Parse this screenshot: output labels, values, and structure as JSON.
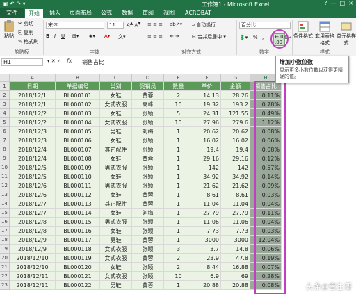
{
  "window": {
    "title": "工作簿1 - Microsoft Excel",
    "controls": [
      "?",
      "—",
      "□",
      "×"
    ]
  },
  "ribbon_tabs": [
    "文件",
    "开始",
    "插入",
    "页面布局",
    "公式",
    "数据",
    "审阅",
    "视图",
    "ACROBAT"
  ],
  "active_tab": "开始",
  "clipboard": {
    "paste": "粘贴",
    "cut": "剪切",
    "copy": "复制",
    "format_painter": "格式刷",
    "label": "剪贴板"
  },
  "font": {
    "name": "宋体",
    "size": "11",
    "label": "字体"
  },
  "alignment": {
    "wrap": "自动换行",
    "merge": "合并后居中",
    "label": "对齐方式"
  },
  "number": {
    "format": "百分比",
    "label": "数字"
  },
  "styles": {
    "conditional": "条件格式",
    "table": "套用表格格式",
    "cell_styles": "单元格样式",
    "label": "样式"
  },
  "tooltip": {
    "title": "增加小数位数",
    "desc": "显示更多小数位数以获得更精确的值。"
  },
  "formula_bar": {
    "cell_ref": "H1",
    "fx": "fx",
    "content": "销售占比"
  },
  "columns": [
    "A",
    "B",
    "C",
    "D",
    "E",
    "F",
    "G",
    "H"
  ],
  "rows": [
    "1",
    "2",
    "3",
    "4",
    "5",
    "6",
    "7",
    "8",
    "9",
    "10",
    "11",
    "12",
    "13",
    "14",
    "15",
    "16",
    "17",
    "18",
    "19",
    "20",
    "21",
    "22",
    "23"
  ],
  "table": {
    "headers": [
      "日期",
      "单据编号",
      "类别",
      "促销员",
      "数量",
      "单价",
      "金额",
      "销售占比"
    ],
    "data": [
      [
        "2018/12/1",
        "BL000101",
        "女鞋",
        "黄蓉",
        "2",
        "14.13",
        "28.26",
        "0.11%"
      ],
      [
        "2018/12/1",
        "BL000102",
        "女式衣服",
        "高峰",
        "10",
        "19.32",
        "193.2",
        "0.78%"
      ],
      [
        "2018/12/2",
        "BL000103",
        "女鞋",
        "张颖",
        "5",
        "24.31",
        "121.55",
        "0.49%"
      ],
      [
        "2018/12/2",
        "BL000104",
        "女式衣服",
        "张颖",
        "10",
        "27.96",
        "279.6",
        "1.12%"
      ],
      [
        "2018/12/3",
        "BL000105",
        "男鞋",
        "刘梅",
        "1",
        "20.62",
        "20.62",
        "0.08%"
      ],
      [
        "2018/12/3",
        "BL000106",
        "女鞋",
        "张颖",
        "1",
        "16.02",
        "16.02",
        "0.06%"
      ],
      [
        "2018/12/4",
        "BL000107",
        "其它配件",
        "张颖",
        "1",
        "19.4",
        "19.4",
        "0.08%"
      ],
      [
        "2018/12/4",
        "BL000108",
        "女鞋",
        "黄蓉",
        "1",
        "29.16",
        "29.16",
        "0.12%"
      ],
      [
        "2018/12/5",
        "BL000109",
        "男式衣服",
        "张颖",
        "1",
        "142",
        "142",
        "0.57%"
      ],
      [
        "2018/12/5",
        "BL000110",
        "女鞋",
        "张颖",
        "1",
        "34.92",
        "34.92",
        "0.14%"
      ],
      [
        "2018/12/6",
        "BL000111",
        "男式衣服",
        "张颖",
        "1",
        "21.62",
        "21.62",
        "0.09%"
      ],
      [
        "2018/12/6",
        "BL000112",
        "女鞋",
        "黄蓉",
        "1",
        "8.61",
        "8.61",
        "0.03%"
      ],
      [
        "2018/12/7",
        "BL000113",
        "其它配件",
        "黄蓉",
        "1",
        "11.04",
        "11.04",
        "0.04%"
      ],
      [
        "2018/12/7",
        "BL000114",
        "女鞋",
        "刘梅",
        "1",
        "27.79",
        "27.79",
        "0.11%"
      ],
      [
        "2018/12/8",
        "BL000115",
        "男式衣服",
        "张颖",
        "1",
        "11.06",
        "11.06",
        "0.04%"
      ],
      [
        "2018/12/8",
        "BL000116",
        "女鞋",
        "张颖",
        "1",
        "7.73",
        "7.73",
        "0.03%"
      ],
      [
        "2018/12/9",
        "BL000117",
        "男鞋",
        "黄蓉",
        "1",
        "3000",
        "3000",
        "12.04%"
      ],
      [
        "2018/12/9",
        "BL000118",
        "女式衣服",
        "张颖",
        "3",
        "3.7",
        "14.8",
        "0.06%"
      ],
      [
        "2018/12/10",
        "BL000119",
        "女式衣服",
        "黄蓉",
        "2",
        "23.9",
        "47.8",
        "0.19%"
      ],
      [
        "2018/12/10",
        "BL000120",
        "女鞋",
        "张颖",
        "2",
        "8.44",
        "16.88",
        "0.07%"
      ],
      [
        "2018/12/11",
        "BL000121",
        "女式衣服",
        "张颖",
        "10",
        "6.9",
        "69",
        "0.28%"
      ],
      [
        "2018/12/11",
        "BL000122",
        "男鞋",
        "黄蓉",
        "1",
        "20.88",
        "20.88",
        "0.08%"
      ]
    ]
  },
  "watermark": "头条@宫生哥"
}
